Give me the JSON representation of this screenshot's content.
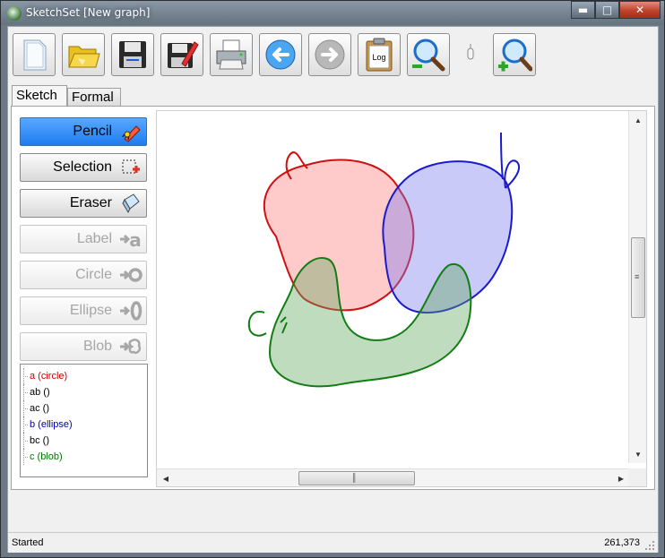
{
  "window": {
    "title": "SketchSet [New graph]"
  },
  "toolbar": {
    "buttons": [
      {
        "name": "new-document-button",
        "icon": "new-document-icon"
      },
      {
        "name": "open-folder-button",
        "icon": "open-folder-icon"
      },
      {
        "name": "save-button",
        "icon": "floppy-disk-icon"
      },
      {
        "name": "save-as-button",
        "icon": "floppy-pencil-icon"
      },
      {
        "name": "print-button",
        "icon": "printer-icon"
      },
      {
        "name": "undo-button",
        "icon": "back-arrow-icon"
      },
      {
        "name": "redo-button",
        "icon": "forward-arrow-icon"
      },
      {
        "name": "log-button",
        "icon": "clipboard-log-icon"
      },
      {
        "name": "zoom-out-button",
        "icon": "zoom-out-icon"
      },
      {
        "name": "zoom-in-button",
        "icon": "zoom-in-icon"
      }
    ],
    "log_label": "Log"
  },
  "tabs": [
    {
      "label": "Sketch",
      "active": true
    },
    {
      "label": "Formal",
      "active": false
    }
  ],
  "tools": [
    {
      "label": "Pencil",
      "icon": "pencil-icon",
      "state": "active"
    },
    {
      "label": "Selection",
      "icon": "selection-icon",
      "state": "enabled"
    },
    {
      "label": "Eraser",
      "icon": "eraser-icon",
      "state": "enabled"
    },
    {
      "label": "Label",
      "icon": "label-icon",
      "state": "disabled"
    },
    {
      "label": "Circle",
      "icon": "circle-icon",
      "state": "disabled"
    },
    {
      "label": "Ellipse",
      "icon": "ellipse-icon",
      "state": "disabled"
    },
    {
      "label": "Blob",
      "icon": "blob-icon",
      "state": "disabled"
    }
  ],
  "set_list": [
    {
      "label": "a (circle)",
      "color": "#cc0000"
    },
    {
      "label": "ab ()",
      "color": "#000000"
    },
    {
      "label": "ac ()",
      "color": "#000000"
    },
    {
      "label": "b (ellipse)",
      "color": "#0000aa"
    },
    {
      "label": "bc ()",
      "color": "#000000"
    },
    {
      "label": "c (blob)",
      "color": "#007700"
    }
  ],
  "sketch": {
    "shapes": [
      {
        "set": "a",
        "color": "#d01010",
        "fill": "#ff9090"
      },
      {
        "set": "b",
        "color": "#1a1ad0",
        "fill": "#8a8af5"
      },
      {
        "set": "c",
        "color": "#127d12",
        "fill": "#7fbf7f"
      }
    ]
  },
  "status": {
    "text": "Started",
    "coords": "261,373"
  }
}
